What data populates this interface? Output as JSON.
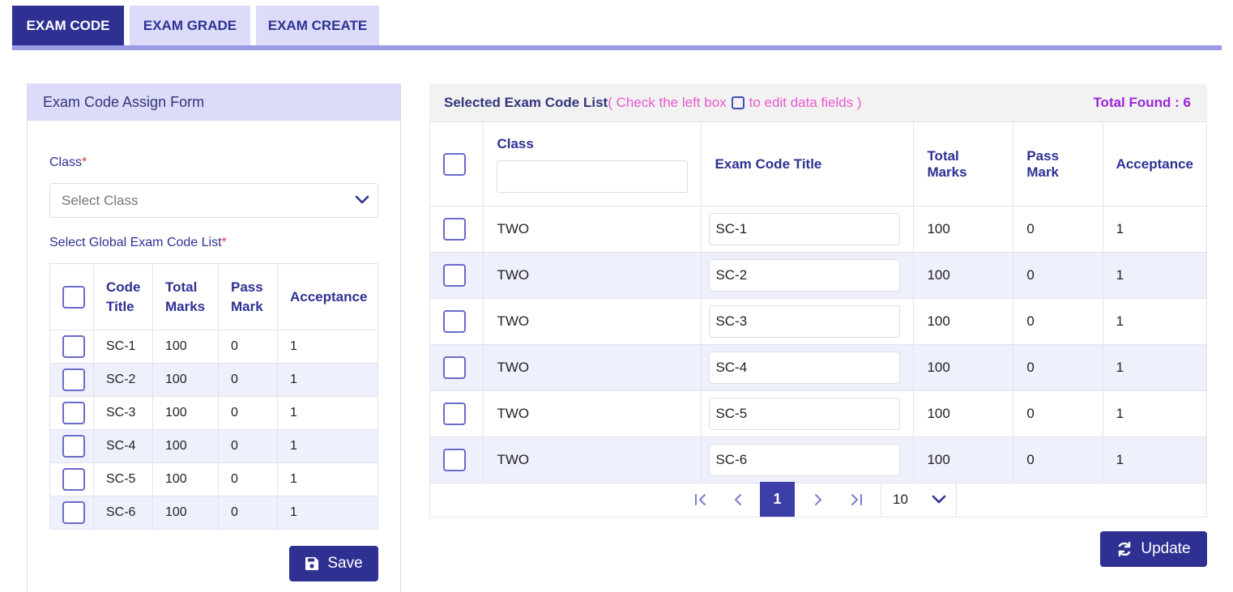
{
  "tabs": [
    {
      "label": "EXAM CODE",
      "active": true
    },
    {
      "label": "EXAM GRADE",
      "active": false
    },
    {
      "label": "EXAM CREATE",
      "active": false
    }
  ],
  "assign_form": {
    "title": "Exam Code Assign Form",
    "class_label": "Class",
    "class_placeholder": "Select Class",
    "global_list_label": "Select Global Exam Code List",
    "required_mark": "*",
    "columns": [
      "Code Title",
      "Total Marks",
      "Pass Mark",
      "Acceptance"
    ],
    "rows": [
      {
        "code": "SC-1",
        "total": "100",
        "pass": "0",
        "acceptance": "1"
      },
      {
        "code": "SC-2",
        "total": "100",
        "pass": "0",
        "acceptance": "1"
      },
      {
        "code": "SC-3",
        "total": "100",
        "pass": "0",
        "acceptance": "1"
      },
      {
        "code": "SC-4",
        "total": "100",
        "pass": "0",
        "acceptance": "1"
      },
      {
        "code": "SC-5",
        "total": "100",
        "pass": "0",
        "acceptance": "1"
      },
      {
        "code": "SC-6",
        "total": "100",
        "pass": "0",
        "acceptance": "1"
      }
    ],
    "save_label": "Save"
  },
  "selected_list": {
    "title": "Selected Exam Code List",
    "hint_before": "( Check the left box",
    "hint_after": "to edit data fields )",
    "total_found": "Total Found : 6",
    "columns": [
      "Class",
      "Exam Code Title",
      "Total Marks",
      "Pass Mark",
      "Acceptance"
    ],
    "class_filter_value": "",
    "rows": [
      {
        "class": "TWO",
        "code": "SC-1",
        "total": "100",
        "pass": "0",
        "acceptance": "1"
      },
      {
        "class": "TWO",
        "code": "SC-2",
        "total": "100",
        "pass": "0",
        "acceptance": "1"
      },
      {
        "class": "TWO",
        "code": "SC-3",
        "total": "100",
        "pass": "0",
        "acceptance": "1"
      },
      {
        "class": "TWO",
        "code": "SC-4",
        "total": "100",
        "pass": "0",
        "acceptance": "1"
      },
      {
        "class": "TWO",
        "code": "SC-5",
        "total": "100",
        "pass": "0",
        "acceptance": "1"
      },
      {
        "class": "TWO",
        "code": "SC-6",
        "total": "100",
        "pass": "0",
        "acceptance": "1"
      }
    ],
    "pagination": {
      "current_page": "1",
      "page_size": "10"
    },
    "update_label": "Update"
  },
  "colors": {
    "primary": "#2e3192",
    "tab_inactive": "#dcdcfa",
    "tab_bar": "#9a9ae6",
    "hint": "#e75ad0",
    "total": "#9b27d8",
    "row_alt": "#eef0fc"
  },
  "icons": {
    "save": "floppy-disk-icon",
    "update": "refresh-icon",
    "select": "chevron-down-icon"
  }
}
